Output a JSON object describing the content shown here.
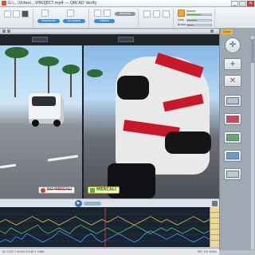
{
  "window": {
    "title": "G:\\...\\Video\\...\\PROJECT.mp4 — QRCAD Verify",
    "buttons": [
      "_",
      "□",
      "×"
    ]
  },
  "ribbon": {
    "pills": [
      {
        "label": "Segmenta",
        "color": "#3c8ad8"
      },
      {
        "label": "Annotate",
        "color": "#3c8ad8"
      },
      {
        "label": "Detect",
        "color": "#3c8ad8"
      },
      {
        "label": "Analyze",
        "color": "#8b97a3"
      }
    ],
    "gauges": [
      {
        "label": "Speed",
        "value": 0.55
      },
      {
        "label": "Lean",
        "value": 0.4
      },
      {
        "label": "Brake",
        "value": 0.25
      }
    ]
  },
  "sidebar": {
    "tab_label": "Layer",
    "buttons": [
      {
        "name": "navigate-icon",
        "glyph": "✛"
      },
      {
        "name": "crosshair-icon",
        "glyph": "+"
      },
      {
        "name": "delete-icon",
        "glyph": "✕"
      }
    ],
    "swatches": [
      "#b3c3d2",
      "#c94d55",
      "#5fae64",
      "#6a9fc8",
      "#bcc7d2"
    ]
  },
  "badges": {
    "reject": "NO MERCALI",
    "accept": "MERCALI"
  },
  "status": {
    "left": "ID 1234  T 00:01:23.45  F 2480",
    "right": "SEL 1/4  100%"
  },
  "colors": {
    "accent": "#f4a62a",
    "accept": "#5cae3a",
    "reject": "#d43a2a"
  },
  "chart_data": {
    "type": "line",
    "title": "",
    "series": [
      {
        "values": [
          2,
          3,
          2,
          4,
          3,
          5,
          4,
          3,
          2,
          3,
          4,
          6,
          5,
          4,
          3,
          2,
          4,
          5,
          3,
          2,
          3,
          4,
          5,
          4,
          3,
          2,
          3,
          5,
          6,
          5,
          4,
          3,
          4,
          5,
          4,
          3,
          2,
          3,
          4,
          3
        ]
      },
      {
        "values": [
          6,
          5,
          7,
          6,
          5,
          6,
          7,
          8,
          6,
          5,
          6,
          7,
          6,
          5,
          7,
          8,
          7,
          6,
          5,
          6,
          7,
          6,
          5,
          6,
          7,
          8,
          7,
          6,
          5,
          6,
          7,
          6,
          7,
          6,
          5,
          6,
          7,
          6,
          5,
          6
        ]
      },
      {
        "values": [
          9,
          10,
          9,
          8,
          9,
          10,
          11,
          10,
          9,
          10,
          9,
          8,
          9,
          10,
          11,
          10,
          9,
          8,
          9,
          10,
          9,
          10,
          11,
          10,
          9,
          8,
          9,
          10,
          11,
          10,
          9,
          10,
          9,
          8,
          9,
          10,
          11,
          10,
          9,
          10
        ]
      }
    ],
    "ylim": [
      0,
      14
    ]
  }
}
